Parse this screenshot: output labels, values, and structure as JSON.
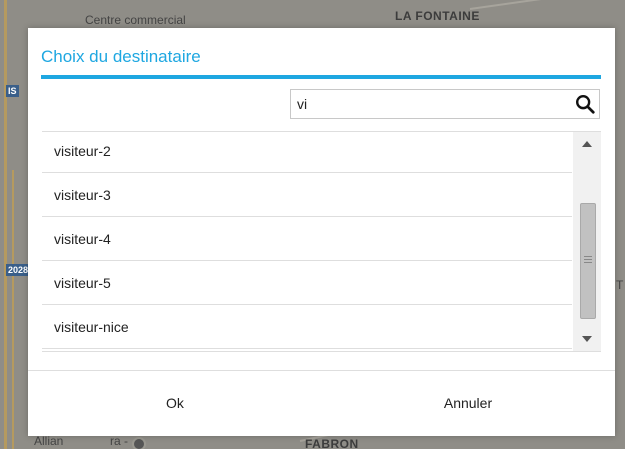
{
  "map": {
    "labels": {
      "top_left": "Centre commercial",
      "top_right": "LA FONTAINE",
      "left_upper": "IS",
      "left_shield": "2028",
      "bottom_left": "Allian",
      "bottom_left_extra": "ra -",
      "bottom_center": "FABRON",
      "right_mid": "T"
    }
  },
  "dialog": {
    "title": "Choix du destinataire",
    "search": {
      "value": "vi",
      "placeholder": ""
    },
    "items": [
      {
        "label": "visiteur-2"
      },
      {
        "label": "visiteur-3"
      },
      {
        "label": "visiteur-4"
      },
      {
        "label": "visiteur-5"
      },
      {
        "label": "visiteur-nice"
      }
    ],
    "scroll_position": 0.5,
    "ok_label": "Ok",
    "cancel_label": "Annuler"
  },
  "colors": {
    "accent": "#1ea7e1"
  },
  "icons": {
    "search": "search-icon",
    "scroll_up": "arrow-up-icon",
    "scroll_down": "arrow-down-icon"
  }
}
